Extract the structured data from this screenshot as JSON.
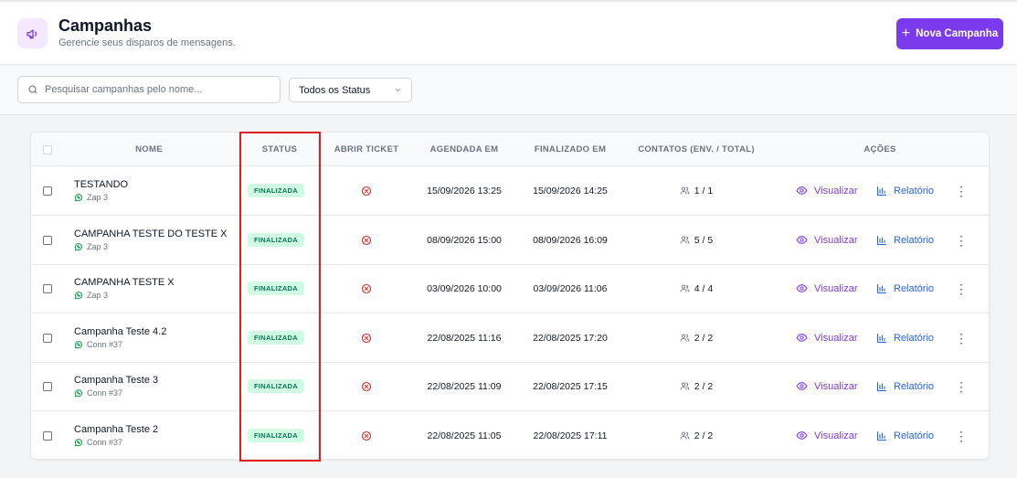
{
  "header": {
    "title": "Campanhas",
    "subtitle": "Gerencie seus disparos de mensagens.",
    "new_button": "Nova Campanha"
  },
  "filters": {
    "search_placeholder": "Pesquisar campanhas pelo nome...",
    "status_value": "Todos os Status"
  },
  "table": {
    "columns": {
      "name": "NOME",
      "status": "STATUS",
      "open_ticket": "ABRIR TICKET",
      "scheduled": "AGENDADA EM",
      "finished": "FINALIZADO EM",
      "contacts": "CONTATOS (ENV. / TOTAL)",
      "actions": "AÇÕES"
    },
    "view_label": "Visualizar",
    "report_label": "Relatório",
    "rows": [
      {
        "name": "TESTANDO",
        "connection": "Zap 3",
        "status": "FINALIZADA",
        "scheduled": "15/09/2026 13:25",
        "finished": "15/09/2026 14:25",
        "contacts": "1 / 1"
      },
      {
        "name": "CAMPANHA TESTE DO TESTE X",
        "connection": "Zap 3",
        "status": "FINALIZADA",
        "scheduled": "08/09/2026 15:00",
        "finished": "08/09/2026 16:09",
        "contacts": "5 / 5"
      },
      {
        "name": "CAMPANHA TESTE X",
        "connection": "Zap 3",
        "status": "FINALIZADA",
        "scheduled": "03/09/2026 10:00",
        "finished": "03/09/2026 11:06",
        "contacts": "4 / 4"
      },
      {
        "name": "Campanha Teste 4.2",
        "connection": "Conn #37",
        "status": "FINALIZADA",
        "scheduled": "22/08/2025 11:16",
        "finished": "22/08/2025 17:20",
        "contacts": "2 / 2"
      },
      {
        "name": "Campanha Teste 3",
        "connection": "Conn #37",
        "status": "FINALIZADA",
        "scheduled": "22/08/2025 11:09",
        "finished": "22/08/2025 17:15",
        "contacts": "2 / 2"
      },
      {
        "name": "Campanha Teste 2",
        "connection": "Conn #37",
        "status": "FINALIZADA",
        "scheduled": "22/08/2025 11:05",
        "finished": "22/08/2025 17:11",
        "contacts": "2 / 2"
      }
    ]
  },
  "colors": {
    "accent": "#7c3aed",
    "status_bg": "#d1fae5",
    "status_text": "#047857",
    "ticket_icon": "#dc2626",
    "highlight": "#e11d1d"
  },
  "icons": {
    "logo": "megaphone-icon",
    "search": "search-icon",
    "select": "chevron-down-icon",
    "connection": "whatsapp-icon",
    "ticket": "x-circle-icon",
    "contacts": "users-icon",
    "view": "eye-icon",
    "report": "bar-chart-icon",
    "menu": "kebab-menu-icon"
  }
}
